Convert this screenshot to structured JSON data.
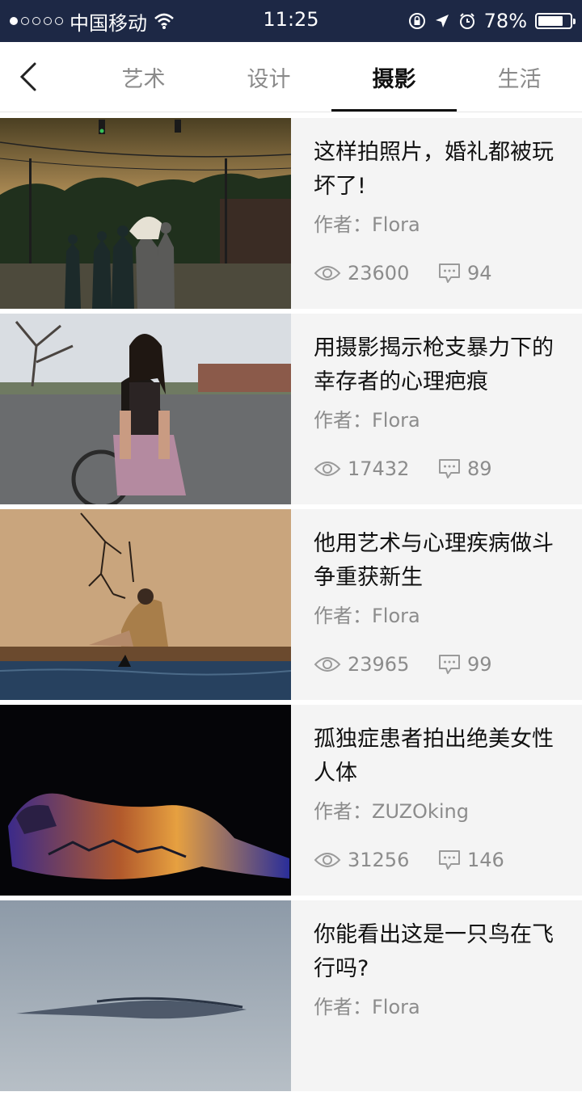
{
  "status_bar": {
    "carrier": "中国移动",
    "time": "11:25",
    "battery": "78%",
    "battery_level": 0.78
  },
  "nav": {
    "tabs": [
      {
        "label": "艺术"
      },
      {
        "label": "设计"
      },
      {
        "label": "摄影"
      },
      {
        "label": "生活"
      }
    ]
  },
  "articles": [
    {
      "title": "这样拍照片，婚礼都被玩坏了!",
      "author": "作者：Flora",
      "views": "23600",
      "comments": "94"
    },
    {
      "title": "用摄影揭示枪支暴力下的幸存者的心理疤痕",
      "author": "作者：Flora",
      "views": "17432",
      "comments": "89"
    },
    {
      "title": "他用艺术与心理疾病做斗争重获新生",
      "author": "作者：Flora",
      "views": "23965",
      "comments": "99"
    },
    {
      "title": "孤独症患者拍出绝美女性人体",
      "author": "作者：ZUZOking",
      "views": "31256",
      "comments": "146"
    },
    {
      "title": "你能看出这是一只鸟在飞行吗?",
      "author": "作者：Flora",
      "views": "",
      "comments": ""
    }
  ]
}
